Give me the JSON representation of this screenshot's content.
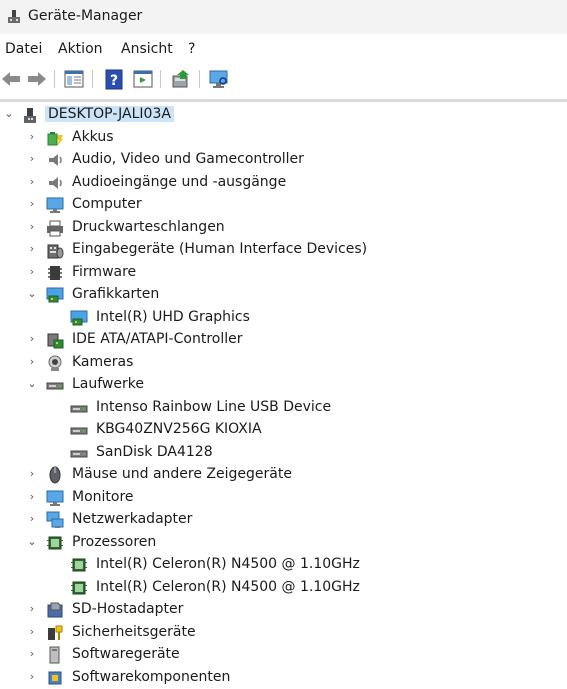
{
  "window": {
    "title": "Geräte-Manager"
  },
  "menu": [
    {
      "label": "Datei",
      "key": "datei"
    },
    {
      "label": "Aktion",
      "key": "aktion"
    },
    {
      "label": "Ansicht",
      "key": "ansicht"
    },
    {
      "label": "?",
      "key": "help"
    }
  ],
  "toolbar": [
    "back-icon",
    "forward-icon",
    "properties-icon",
    "help-icon",
    "show-hide-icon",
    "update-driver-icon",
    "scan-hardware-icon"
  ],
  "tree": {
    "root": {
      "label": "DESKTOP-JALI03A",
      "icon": "computer-root-icon",
      "expanded": true
    },
    "categories": [
      {
        "label": "Akkus",
        "icon": "battery-icon",
        "expanded": false,
        "children": []
      },
      {
        "label": "Audio, Video und Gamecontroller",
        "icon": "speaker-icon",
        "expanded": false,
        "children": []
      },
      {
        "label": "Audioeingänge und -ausgänge",
        "icon": "speaker-icon",
        "expanded": false,
        "children": []
      },
      {
        "label": "Computer",
        "icon": "monitor-icon",
        "expanded": false,
        "children": []
      },
      {
        "label": "Druckwarteschlangen",
        "icon": "printer-icon",
        "expanded": false,
        "children": []
      },
      {
        "label": "Eingabegeräte (Human Interface Devices)",
        "icon": "hid-icon",
        "expanded": false,
        "children": []
      },
      {
        "label": "Firmware",
        "icon": "firmware-icon",
        "expanded": false,
        "children": []
      },
      {
        "label": "Grafikkarten",
        "icon": "display-adapter-icon",
        "expanded": true,
        "children": [
          {
            "label": "Intel(R) UHD Graphics",
            "icon": "display-adapter-icon"
          }
        ]
      },
      {
        "label": "IDE ATA/ATAPI-Controller",
        "icon": "ide-controller-icon",
        "expanded": false,
        "children": []
      },
      {
        "label": "Kameras",
        "icon": "camera-icon",
        "expanded": false,
        "children": []
      },
      {
        "label": "Laufwerke",
        "icon": "drive-icon",
        "expanded": true,
        "children": [
          {
            "label": "Intenso Rainbow Line USB Device",
            "icon": "drive-icon"
          },
          {
            "label": "KBG40ZNV256G KIOXIA",
            "icon": "drive-icon"
          },
          {
            "label": "SanDisk DA4128",
            "icon": "drive-icon"
          }
        ]
      },
      {
        "label": "Mäuse und andere Zeigegeräte",
        "icon": "mouse-icon",
        "expanded": false,
        "children": []
      },
      {
        "label": "Monitore",
        "icon": "monitor-icon",
        "expanded": false,
        "children": []
      },
      {
        "label": "Netzwerkadapter",
        "icon": "network-adapter-icon",
        "expanded": false,
        "children": []
      },
      {
        "label": "Prozessoren",
        "icon": "processor-icon",
        "expanded": true,
        "children": [
          {
            "label": "Intel(R) Celeron(R) N4500 @ 1.10GHz",
            "icon": "processor-icon"
          },
          {
            "label": "Intel(R) Celeron(R) N4500 @ 1.10GHz",
            "icon": "processor-icon"
          }
        ]
      },
      {
        "label": "SD-Hostadapter",
        "icon": "sd-host-icon",
        "expanded": false,
        "children": []
      },
      {
        "label": "Sicherheitsgeräte",
        "icon": "security-device-icon",
        "expanded": false,
        "children": []
      },
      {
        "label": "Softwaregeräte",
        "icon": "software-device-icon",
        "expanded": false,
        "children": []
      },
      {
        "label": "Softwarekomponenten",
        "icon": "software-component-icon",
        "expanded": false,
        "children": []
      }
    ]
  },
  "colors": {
    "selection": "#cce4f7",
    "chrome": "#f3f3f3"
  }
}
